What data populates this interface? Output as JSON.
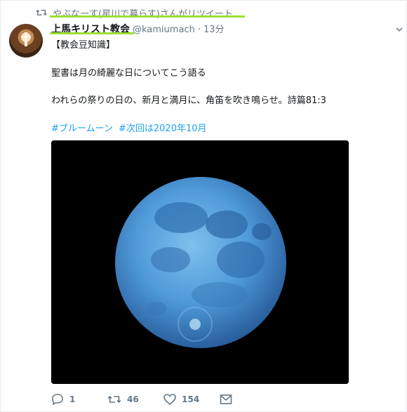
{
  "retweet_context": {
    "text": "やぶなーす(星川で暮らす)さんがリツイート"
  },
  "author": {
    "name": "上馬キリスト教会",
    "handle": "@kamiumach",
    "time": "13分"
  },
  "tweet": {
    "line1": "【教会豆知識】",
    "line2": "聖書は月の綺麗な日についてこう語る",
    "line3": "われらの祭りの日の、新月と満月に、角笛を吹き鳴らせ。詩篇81:3",
    "hashtags": [
      "#ブルームーン",
      "#次回は2020年10月"
    ]
  },
  "actions": {
    "replies": "1",
    "retweets": "46",
    "likes": "154"
  },
  "colors": {
    "accent": "#1da1f2",
    "highlight": "#9be032",
    "muted": "#657786"
  },
  "icons": [
    "retweet-icon",
    "chevron-down-icon",
    "reply-icon",
    "retweet-icon",
    "heart-icon",
    "message-icon"
  ]
}
